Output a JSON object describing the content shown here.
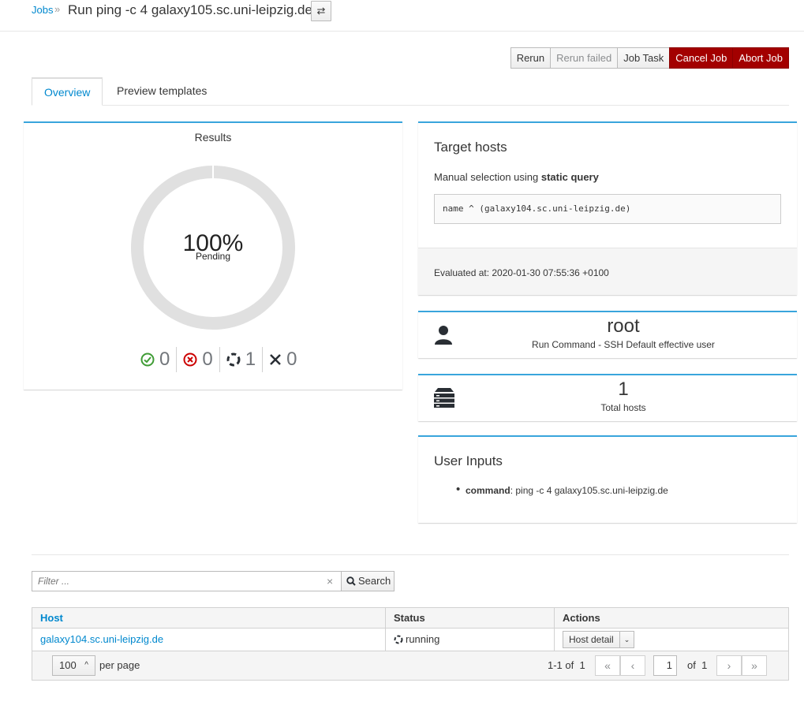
{
  "breadcrumb": {
    "root": "Jobs",
    "separator": "»",
    "title": "Run ping -c 4 galaxy105.sc.uni-leipzig.de",
    "switch_icon": "⇄"
  },
  "actions": {
    "rerun": "Rerun",
    "rerun_failed": "Rerun failed",
    "job_task": "Job Task",
    "cancel": "Cancel Job",
    "abort": "Abort Job"
  },
  "tabs": [
    {
      "label": "Overview"
    },
    {
      "label": "Preview templates"
    }
  ],
  "results": {
    "title": "Results",
    "percent": "100%",
    "label": "Pending",
    "counts": {
      "success": "0",
      "failed": "0",
      "pending": "1",
      "cancelled": "0"
    },
    "colors": {
      "success": "#3f9c35",
      "failed": "#cc0000",
      "ring": "#e0e0e0"
    }
  },
  "target": {
    "title": "Target hosts",
    "selection_prefix": "Manual selection using",
    "selection_type": "static query",
    "query": "name ^ (galaxy104.sc.uni-leipzig.de)",
    "evaluated": "Evaluated at: 2020-01-30 07:55:36 +0100"
  },
  "user": {
    "value": "root",
    "label": "Run Command - SSH Default effective user"
  },
  "hosts": {
    "value": "1",
    "label": "Total hosts"
  },
  "inputs": {
    "title": "User Inputs",
    "key": "command",
    "value": ": ping -c 4 galaxy105.sc.uni-leipzig.de"
  },
  "search": {
    "placeholder": "Filter ...",
    "clear": "×",
    "button": "Search"
  },
  "table": {
    "headers": [
      "Host",
      "Status",
      "Actions"
    ],
    "rows": [
      {
        "host": "galaxy104.sc.uni-leipzig.de",
        "status": "running",
        "action": "Host detail"
      }
    ]
  },
  "pager": {
    "per_page": "100",
    "per_page_label": "per page",
    "range": "1-1 of",
    "range_total": "1",
    "page": "1",
    "of": "of",
    "total_pages": "1"
  }
}
